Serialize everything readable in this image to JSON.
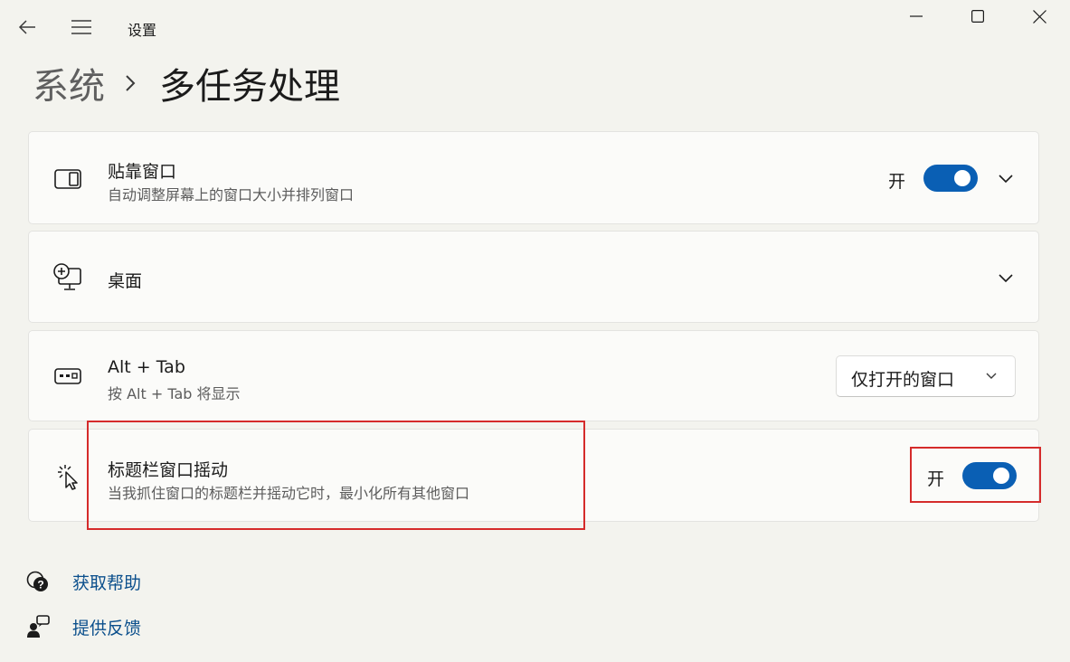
{
  "window": {
    "title": "设置",
    "controls": [
      "minimize-icon",
      "maximize-icon",
      "close-icon"
    ]
  },
  "nav": {
    "back_icon": "arrow-left-icon",
    "menu_icon": "hamburger-icon"
  },
  "breadcrumb": {
    "parent": "系统",
    "separator_icon": "chevron-right-icon",
    "current": "多任务处理"
  },
  "settings": [
    {
      "id": "snap-windows",
      "icon": "snap-window-icon",
      "title": "贴靠窗口",
      "subtitle": "自动调整屏幕上的窗口大小并排列窗口",
      "toggle_label": "开",
      "toggle_on": true,
      "expandable": true
    },
    {
      "id": "desktops",
      "icon": "desktop-add-icon",
      "title": "桌面",
      "expandable": true
    },
    {
      "id": "alt-tab",
      "icon": "keyboard-tab-icon",
      "title": "Alt + Tab",
      "subtitle": "按 Alt + Tab 将显示",
      "dropdown_value": "仅打开的窗口"
    },
    {
      "id": "title-bar-shake",
      "icon": "cursor-shake-icon",
      "title": "标题栏窗口摇动",
      "subtitle": "当我抓住窗口的标题栏并摇动它时，最小化所有其他窗口",
      "toggle_label": "开",
      "toggle_on": true
    }
  ],
  "links": [
    {
      "icon": "help-chat-icon",
      "label": "获取帮助"
    },
    {
      "icon": "feedback-person-icon",
      "label": "提供反馈"
    }
  ],
  "colors": {
    "accent": "#0a5fb4",
    "highlight": "#d52b2b",
    "link": "#0b4f8c",
    "background": "#f3f3ee"
  }
}
